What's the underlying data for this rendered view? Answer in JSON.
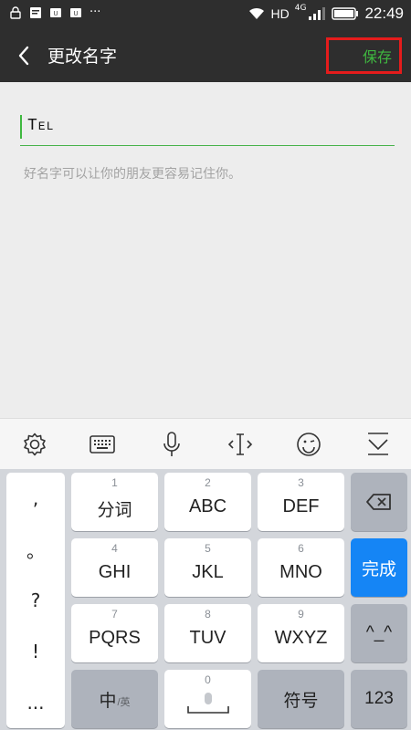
{
  "status_bar": {
    "more": "···",
    "network": "HD",
    "signal_gen": "4G",
    "time": "22:49"
  },
  "title_bar": {
    "title": "更改名字",
    "save_label": "保存"
  },
  "content": {
    "name_value": "Tel",
    "hint": "好名字可以让你的朋友更容易记住你。"
  },
  "keyboard": {
    "punct": [
      ",",
      "。",
      "?",
      "!",
      "..."
    ],
    "keys": {
      "k1": {
        "num": "1",
        "label": "分词"
      },
      "k2": {
        "num": "2",
        "label": "ABC"
      },
      "k3": {
        "num": "3",
        "label": "DEF"
      },
      "k4": {
        "num": "4",
        "label": "GHI"
      },
      "k5": {
        "num": "5",
        "label": "JKL"
      },
      "k6": {
        "num": "6",
        "label": "MNO"
      },
      "k7": {
        "num": "7",
        "label": "PQRS"
      },
      "k8": {
        "num": "8",
        "label": "TUV"
      },
      "k9": {
        "num": "9",
        "label": "WXYZ"
      },
      "k0": {
        "num": "0"
      }
    },
    "done_label": "完成",
    "emoticon_label": "^_^",
    "lang_main": "中",
    "lang_sub": "/英",
    "symbol_label": "符号",
    "num_label": "123"
  },
  "colors": {
    "header_bg": "#2e2e2e",
    "accent_green": "#3fb840",
    "highlight_red": "#e51c1c",
    "done_blue": "#1585f5"
  }
}
